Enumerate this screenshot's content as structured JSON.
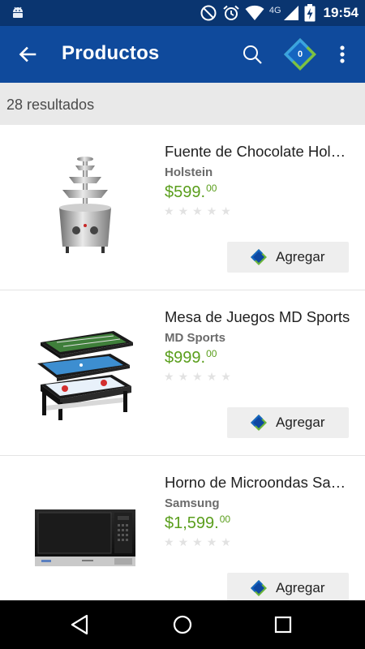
{
  "status_bar": {
    "time": "19:54",
    "network": "4G",
    "icons": [
      "android-icon",
      "dnd-icon",
      "alarm-icon",
      "wifi-icon",
      "signal-icon",
      "battery-charging-icon"
    ]
  },
  "app_bar": {
    "title": "Productos",
    "cart_count": "0",
    "icons": [
      "back-arrow-icon",
      "search-icon",
      "cart-diamond-icon",
      "more-vert-icon"
    ],
    "colors": {
      "background": "#0f4a9c",
      "status": "#0a3570"
    }
  },
  "results": {
    "count_text": "28 resultados"
  },
  "products": [
    {
      "name": "Fuente de Chocolate Holstein",
      "brand": "Holstein",
      "price_main": "$599.",
      "price_cents": "00",
      "rating": 0,
      "add_label": "Agregar"
    },
    {
      "name": "Mesa de Juegos MD Sports",
      "brand": "MD Sports",
      "price_main": "$999.",
      "price_cents": "00",
      "rating": 0,
      "add_label": "Agregar"
    },
    {
      "name": "Horno de Microondas Samsung",
      "brand": "Samsung",
      "price_main": "$1,599.",
      "price_cents": "00",
      "rating": 0,
      "add_label": "Agregar"
    }
  ],
  "nav_bar": {
    "icons": [
      "nav-back-icon",
      "nav-home-icon",
      "nav-recents-icon"
    ]
  },
  "colors": {
    "price": "#5a9e1c",
    "accent_blue": "#1565c0",
    "accent_green": "#7cc242"
  }
}
